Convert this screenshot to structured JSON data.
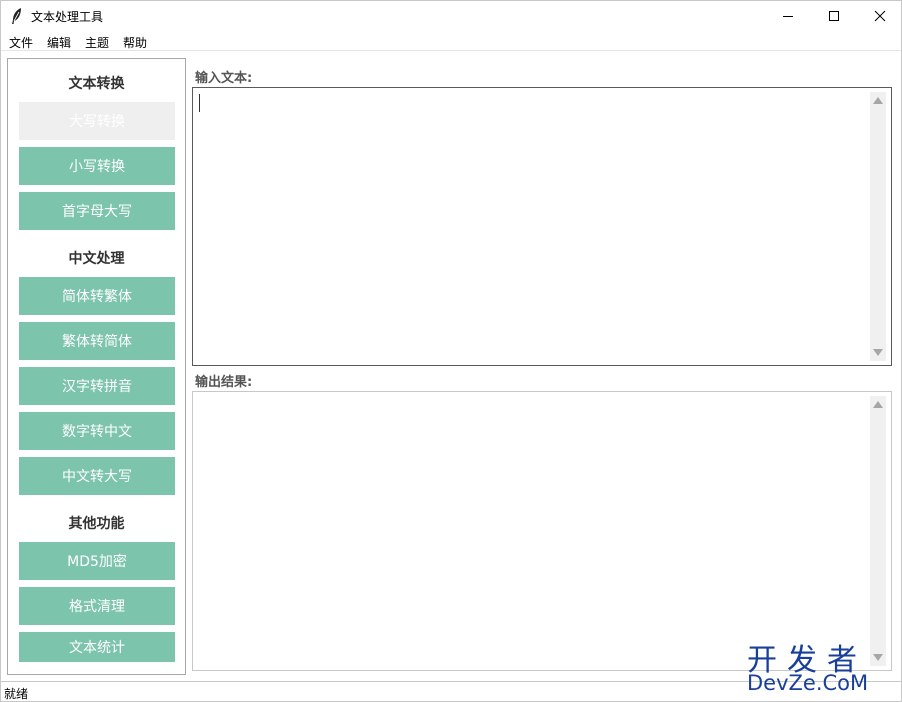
{
  "window": {
    "title": "文本处理工具"
  },
  "menu": {
    "items": [
      "文件",
      "编辑",
      "主题",
      "帮助"
    ]
  },
  "sidebar": {
    "sections": [
      {
        "title": "文本转换",
        "buttons": [
          "大写转换",
          "小写转换",
          "首字母大写"
        ]
      },
      {
        "title": "中文处理",
        "buttons": [
          "简体转繁体",
          "繁体转简体",
          "汉字转拼音",
          "数字转中文",
          "中文转大写"
        ]
      },
      {
        "title": "其他功能",
        "buttons": [
          "MD5加密",
          "格式清理",
          "文本统计"
        ]
      }
    ]
  },
  "content": {
    "input_label": "输入文本:",
    "input_value": "",
    "output_label": "输出结果:",
    "output_value": ""
  },
  "status": {
    "text": "就绪"
  },
  "watermark": {
    "line1": "开发者",
    "line2": "DevZe.CoM"
  },
  "colors": {
    "button": "#7dc4ac",
    "button_disabled": "#efefef",
    "watermark": "#1a3f9a"
  },
  "icons": {
    "app": "feather-icon",
    "minimize": "minimize-icon",
    "maximize": "maximize-icon",
    "close": "close-icon"
  }
}
